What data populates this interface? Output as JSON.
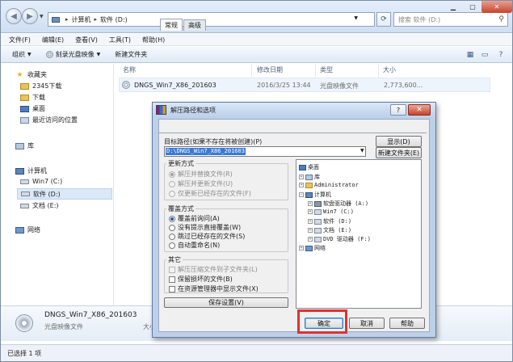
{
  "explorer": {
    "address": [
      "计算机",
      "软件 (D:)"
    ],
    "search_placeholder": "搜索 软件 (D:)",
    "menu": [
      "文件(F)",
      "编辑(E)",
      "查看(V)",
      "工具(T)",
      "帮助(H)"
    ],
    "toolbar": [
      {
        "label": "组织"
      },
      {
        "label": "刻录光盘映像"
      },
      {
        "label": "新建文件夹"
      }
    ],
    "sidebar": [
      {
        "label": "收藏夹",
        "icon": "star-icon"
      },
      {
        "label": "2345下载",
        "icon": "folder-icon"
      },
      {
        "label": "下载",
        "icon": "download-folder-icon"
      },
      {
        "label": "桌面",
        "icon": "desktop-icon"
      },
      {
        "label": "最近访问的位置",
        "icon": "recent-places-icon"
      },
      {
        "label": "库",
        "icon": "library-icon"
      },
      {
        "label": "计算机",
        "icon": "computer-icon"
      },
      {
        "label": "Win7 (C:)",
        "icon": "drive-icon"
      },
      {
        "label": "软件 (D:)",
        "icon": "drive-icon"
      },
      {
        "label": "文档 (E:)",
        "icon": "drive-icon"
      },
      {
        "label": "网络",
        "icon": "network-icon"
      }
    ],
    "columns": [
      "名称",
      "修改日期",
      "类型",
      "大小"
    ],
    "file": {
      "name": "DNGS_Win7_X86_201603",
      "date": "2016/3/25 13:44",
      "type": "光盘映像文件",
      "size": "2,773,600..."
    },
    "details": {
      "name": "DNGS_Win7_X86_201603",
      "type": "光盘映像文件",
      "size_label": "大小"
    },
    "status": "已选择 1 项"
  },
  "dialog": {
    "title": "解压路径和选项",
    "help": "?",
    "close": "✕",
    "tabs": [
      "常规",
      "高级"
    ],
    "path_label": "目标路径(如果不存在将被创建)(P)",
    "path_value": "D:\\DNGS_Win7_X86_201603",
    "show_button": "显示(D)",
    "new_folder_button": "新建文件夹(E)",
    "update_group": {
      "title": "更新方式",
      "options": [
        "解压并替换文件(R)",
        "解压并更新文件(U)",
        "仅更新已经存在的文件(F)"
      ],
      "selected": 0
    },
    "overwrite_group": {
      "title": "覆盖方式",
      "options": [
        "覆盖前询问(A)",
        "没有提示直接覆盖(W)",
        "跳过已经存在的文件(S)",
        "自动重命名(N)"
      ],
      "selected": 0
    },
    "other_group": {
      "title": "其它",
      "options": [
        "解压压缩文件到子文件夹(L)",
        "保留损坏的文件(B)",
        "在资源管理器中显示文件(X)"
      ]
    },
    "save_button": "保存设置(V)",
    "tree": [
      {
        "label": "桌面",
        "level": 0
      },
      {
        "label": "库",
        "level": 1
      },
      {
        "label": "Administrator",
        "level": 1
      },
      {
        "label": "计算机",
        "level": 1
      },
      {
        "label": "软盘驱动器 (A:)",
        "level": 2
      },
      {
        "label": "Win7 (C:)",
        "level": 2
      },
      {
        "label": "软件 (D:)",
        "level": 2
      },
      {
        "label": "文档 (E:)",
        "level": 2
      },
      {
        "label": "DVD 驱动器 (F:)",
        "level": 2
      },
      {
        "label": "网络",
        "level": 1
      }
    ],
    "ok_button": "确定",
    "cancel_button": "取消",
    "help_button": "帮助"
  }
}
